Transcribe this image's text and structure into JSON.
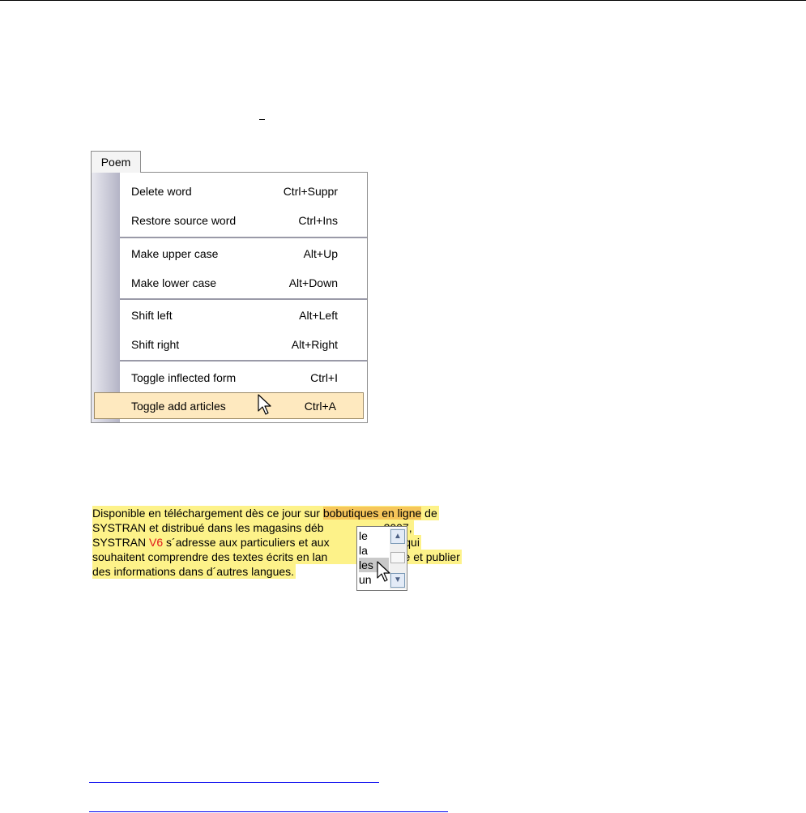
{
  "menu": {
    "title": "Poem",
    "items": [
      {
        "label": "Delete word",
        "shortcut": "Ctrl+Suppr"
      },
      {
        "label": "Restore source word",
        "shortcut": "Ctrl+Ins"
      },
      {
        "label": "Make upper case",
        "shortcut": "Alt+Up"
      },
      {
        "label": "Make lower case",
        "shortcut": "Alt+Down"
      },
      {
        "label": "Shift left",
        "shortcut": "Alt+Left"
      },
      {
        "label": "Shift right",
        "shortcut": "Alt+Right"
      },
      {
        "label": "Toggle inflected form",
        "shortcut": "Ctrl+I"
      },
      {
        "label": "Toggle add articles",
        "shortcut": "Ctrl+A"
      }
    ]
  },
  "text": {
    "line1_a": "Disponible en téléchargement dès ce jour sur ",
    "line1_b": "bobutiques en ligne",
    "line1_c": " de",
    "line2": "SYSTRAN et distribué dans les magasins déb",
    "line2_tail": "2007,",
    "line3_a": "SYSTRAN ",
    "line3_red": "V6",
    "line3_b": " s´adresse aux particuliers et aux",
    "line3_tail": "es qui",
    "line4_a": "souhaitent comprendre des textes écrits en lan",
    "line4_tail": "gère et publier",
    "line5": "des informations dans d´autres langues."
  },
  "dropdown": {
    "options": [
      "le",
      "la",
      "les",
      "un"
    ],
    "selected": "les"
  },
  "colors": {
    "menu_highlight": "#fee9bf",
    "text_highlight": "#fdf289",
    "phrase_highlight": "#f6c65a",
    "accent_red": "#e1171b",
    "link": "#0000ee"
  },
  "icons": {
    "cursor": "arrow-pointer-icon",
    "scroll_up": "chevron-up-icon",
    "scroll_down": "chevron-down-icon"
  }
}
